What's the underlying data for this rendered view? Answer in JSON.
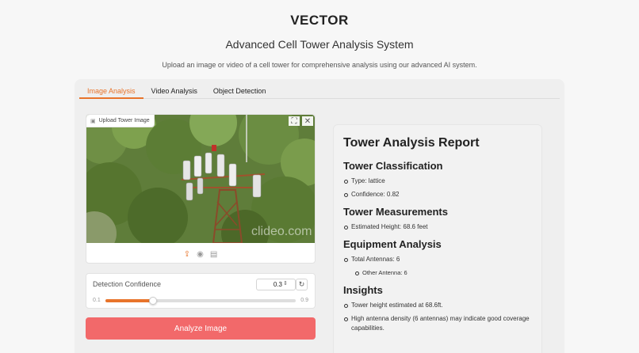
{
  "header": {
    "title": "VECTOR",
    "subtitle": "Advanced Cell Tower Analysis System",
    "description": "Upload an image or video of a cell tower for comprehensive analysis using our advanced AI system."
  },
  "tabs": [
    {
      "label": "Image Analysis",
      "active": true
    },
    {
      "label": "Video Analysis",
      "active": false
    },
    {
      "label": "Object Detection",
      "active": false
    }
  ],
  "upload": {
    "label": "Upload Tower Image",
    "watermark": "clideo.com",
    "icons": [
      "upload-icon",
      "webcam-icon",
      "clipboard-icon"
    ],
    "tools": [
      "fullscreen-icon",
      "close-icon"
    ]
  },
  "confidence": {
    "label": "Detection Confidence",
    "value": "0.3",
    "min": "0.1",
    "max": "0.9",
    "fraction": 0.25
  },
  "analyze_button": "Analyze Image",
  "report": {
    "title": "Tower Analysis Report",
    "classification": {
      "heading": "Tower Classification",
      "type": "Type: lattice",
      "confidence": "Confidence: 0.82"
    },
    "measurements": {
      "heading": "Tower Measurements",
      "height": "Estimated Height: 68.6 feet"
    },
    "equipment": {
      "heading": "Equipment Analysis",
      "total": "Total Antennas: 6",
      "other": "Other Antenna: 6"
    },
    "insights": {
      "heading": "Insights",
      "items": [
        "Tower height estimated at 68.6ft.",
        "High antenna density (6 antennas) may indicate good coverage capabilities."
      ]
    }
  },
  "colors": {
    "accent": "#e8742b",
    "button": "#f2696a"
  }
}
